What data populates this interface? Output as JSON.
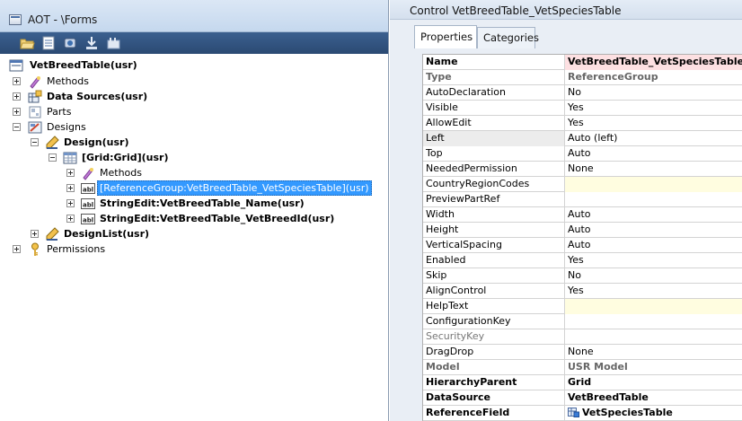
{
  "aot": {
    "title": "AOT - \\Forms",
    "tree": [
      {
        "id": "root",
        "label": "VetBreedTable(usr)",
        "bold": true,
        "icon": "form-icon",
        "expander": "none",
        "selected": false
      },
      {
        "id": "methods",
        "label": "Methods",
        "bold": false,
        "icon": "methods-icon",
        "expander": "plus",
        "selected": false
      },
      {
        "id": "datasources",
        "label": "Data Sources(usr)",
        "bold": true,
        "icon": "datasources-icon",
        "expander": "plus",
        "selected": false
      },
      {
        "id": "parts",
        "label": "Parts",
        "bold": false,
        "icon": "parts-icon",
        "expander": "plus",
        "selected": false
      },
      {
        "id": "designs",
        "label": "Designs",
        "bold": false,
        "icon": "designs-icon",
        "expander": "minus",
        "selected": false
      },
      {
        "id": "design",
        "label": "Design(usr)",
        "bold": true,
        "icon": "design-icon",
        "expander": "minus",
        "selected": false
      },
      {
        "id": "grid",
        "label": "[Grid:Grid](usr)",
        "bold": true,
        "icon": "grid-icon",
        "expander": "minus",
        "selected": false
      },
      {
        "id": "grid-methods",
        "label": "Methods",
        "bold": false,
        "icon": "methods-icon",
        "expander": "plus",
        "selected": false
      },
      {
        "id": "refgroup",
        "label": "[ReferenceGroup:VetBreedTable_VetSpeciesTable](usr)",
        "bold": false,
        "icon": "control-icon",
        "expander": "plus",
        "selected": true
      },
      {
        "id": "str-name",
        "label": "StringEdit:VetBreedTable_Name(usr)",
        "bold": true,
        "icon": "control-icon",
        "expander": "plus",
        "selected": false
      },
      {
        "id": "str-breed",
        "label": "StringEdit:VetBreedTable_VetBreedId(usr)",
        "bold": true,
        "icon": "control-icon",
        "expander": "plus",
        "selected": false
      },
      {
        "id": "designlist",
        "label": "DesignList(usr)",
        "bold": true,
        "icon": "design-icon",
        "expander": "plus",
        "selected": false
      },
      {
        "id": "permissions",
        "label": "Permissions",
        "bold": false,
        "icon": "key-icon",
        "expander": "plus",
        "selected": false
      }
    ]
  },
  "properties": {
    "title": "Control VetBreedTable_VetSpeciesTable",
    "tabs": [
      {
        "label": "Properties",
        "active": true
      },
      {
        "label": "Categories",
        "active": false
      }
    ],
    "rows": [
      {
        "name": "Name",
        "value": "VetBreedTable_VetSpeciesTable",
        "style": "bold",
        "fill": "pink"
      },
      {
        "name": "Type",
        "value": "ReferenceGroup",
        "style": "gray-bold",
        "fill": ""
      },
      {
        "name": "AutoDeclaration",
        "value": "No",
        "style": "",
        "fill": ""
      },
      {
        "name": "Visible",
        "value": "Yes",
        "style": "",
        "fill": ""
      },
      {
        "name": "AllowEdit",
        "value": "Yes",
        "style": "",
        "fill": ""
      },
      {
        "name": "Left",
        "value": "Auto (left)",
        "style": "hl",
        "fill": ""
      },
      {
        "name": "Top",
        "value": "Auto",
        "style": "",
        "fill": ""
      },
      {
        "name": "NeededPermission",
        "value": "None",
        "style": "",
        "fill": ""
      },
      {
        "name": "CountryRegionCodes",
        "value": "",
        "style": "",
        "fill": "yellow"
      },
      {
        "name": "PreviewPartRef",
        "value": "",
        "style": "",
        "fill": ""
      },
      {
        "name": "Width",
        "value": "Auto",
        "style": "",
        "fill": ""
      },
      {
        "name": "Height",
        "value": "Auto",
        "style": "",
        "fill": ""
      },
      {
        "name": "VerticalSpacing",
        "value": "Auto",
        "style": "",
        "fill": ""
      },
      {
        "name": "Enabled",
        "value": "Yes",
        "style": "",
        "fill": ""
      },
      {
        "name": "Skip",
        "value": "No",
        "style": "",
        "fill": ""
      },
      {
        "name": "AlignControl",
        "value": "Yes",
        "style": "",
        "fill": ""
      },
      {
        "name": "HelpText",
        "value": "",
        "style": "",
        "fill": "yellow"
      },
      {
        "name": "ConfigurationKey",
        "value": "",
        "style": "",
        "fill": ""
      },
      {
        "name": "SecurityKey",
        "value": "",
        "style": "gray",
        "fill": ""
      },
      {
        "name": "DragDrop",
        "value": "None",
        "style": "",
        "fill": ""
      },
      {
        "name": "Model",
        "value": "USR Model",
        "style": "gray-bold",
        "fill": ""
      },
      {
        "name": "HierarchyParent",
        "value": "Grid",
        "style": "bold",
        "fill": ""
      },
      {
        "name": "DataSource",
        "value": "VetBreedTable",
        "style": "bold",
        "fill": ""
      },
      {
        "name": "ReferenceField",
        "value": "VetSpeciesTable",
        "style": "bold",
        "fill": "",
        "icon": "table-field-icon"
      }
    ]
  },
  "colors": {
    "toolbar": "#2b4a73",
    "selection": "#3399ff",
    "name_highlight": "#fde0e2",
    "yellow_field": "#fffde0"
  }
}
